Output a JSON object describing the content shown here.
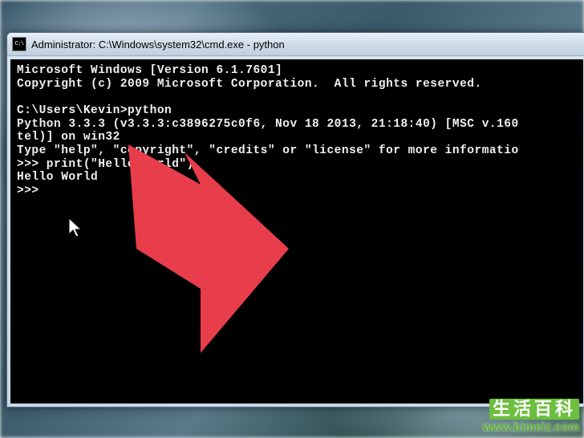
{
  "window": {
    "title": "Administrator: C:\\Windows\\system32\\cmd.exe - python",
    "icon_label": "C:\\"
  },
  "terminal": {
    "lines": [
      "Microsoft Windows [Version 6.1.7601]",
      "Copyright (c) 2009 Microsoft Corporation.  All rights reserved.",
      "",
      "C:\\Users\\Kevin>python",
      "Python 3.3.3 (v3.3.3:c3896275c0f6, Nov 18 2013, 21:18:40) [MSC v.160",
      "tel)] on win32",
      "Type \"help\", \"copyright\", \"credits\" or \"license\" for more informatio",
      ">>> print(\"Hello World\")",
      "Hello World",
      ">>> "
    ]
  },
  "annotation": {
    "arrow_color": "#e83d4a"
  },
  "watermark": {
    "brand": "生活百科",
    "url": "www.bimeiz.com"
  }
}
